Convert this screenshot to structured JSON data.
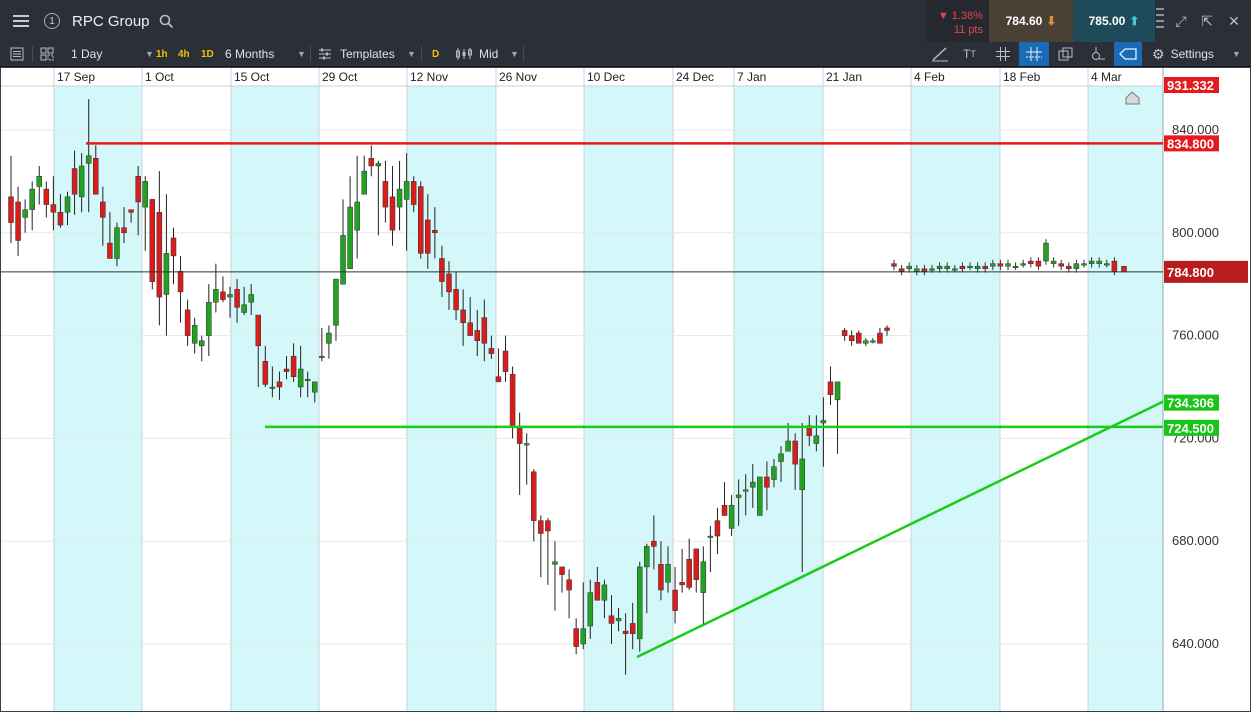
{
  "header": {
    "window_number": "1",
    "instrument": "RPC Group",
    "change_pct": "1.38%",
    "change_pts": "11 pts",
    "sell_price": "784.60",
    "buy_price": "785.00"
  },
  "toolbar": {
    "interval": "1 Day",
    "quick_timeframes": [
      "1h",
      "4h",
      "1D"
    ],
    "range": "6 Months",
    "templates": "Templates",
    "d_badge": "D",
    "price_type": "Mid",
    "settings": "Settings"
  },
  "chart": {
    "date_labels": [
      "17 Sep",
      "1 Oct",
      "15 Oct",
      "29 Oct",
      "12 Nov",
      "26 Nov",
      "10 Dec",
      "24 Dec",
      "7 Jan",
      "21 Jan",
      "4 Feb",
      "18 Feb",
      "4 Mar"
    ],
    "price_ticks": [
      "840.000",
      "800.000",
      "760.000",
      "720.000",
      "680.000",
      "640.000"
    ],
    "tags": {
      "top": "931.332",
      "resistance": "834.800",
      "current": "784.800",
      "trendline": "734.306",
      "support": "724.500"
    },
    "colors": {
      "up": "#22a122",
      "down": "#d81d1d",
      "resistance_line": "#e8191c",
      "support_line": "#18cc18",
      "band": "#d4f7f9",
      "current_tag": "#b81c1c"
    }
  },
  "chart_data": {
    "type": "candlestick",
    "title": "RPC Group",
    "timeframe": "1 Day",
    "y_ticks": [
      640,
      680,
      720,
      760,
      800,
      840
    ],
    "levels": {
      "resistance": 834.8,
      "support": 724.5,
      "current": 784.8,
      "trendline_end": 734.306,
      "axis_top": 931.332
    },
    "ohlc": [
      [
        814,
        830,
        796,
        804
      ],
      [
        812,
        818,
        791,
        797
      ],
      [
        806,
        813,
        800,
        809
      ],
      [
        809,
        820,
        801,
        817
      ],
      [
        818,
        826,
        811,
        822
      ],
      [
        817,
        820,
        806,
        811
      ],
      [
        811,
        822,
        801,
        808
      ],
      [
        808,
        815,
        802,
        803
      ],
      [
        808,
        816,
        803,
        814
      ],
      [
        825,
        832,
        807,
        815
      ],
      [
        814,
        831,
        808,
        826
      ],
      [
        827,
        852,
        808,
        830
      ],
      [
        829,
        834,
        815,
        815
      ],
      [
        812,
        818,
        795,
        806
      ],
      [
        796,
        808,
        790,
        790
      ],
      [
        790,
        804,
        787,
        802
      ],
      [
        802,
        810,
        796,
        800
      ],
      [
        809,
        809,
        804,
        808
      ],
      [
        822,
        826,
        799,
        812
      ],
      [
        810,
        822,
        793,
        820
      ],
      [
        813,
        813,
        778,
        781
      ],
      [
        808,
        824,
        764,
        775
      ],
      [
        776,
        815,
        760,
        792
      ],
      [
        798,
        802,
        780,
        791
      ],
      [
        785,
        791,
        765,
        777
      ],
      [
        770,
        774,
        756,
        760
      ],
      [
        757,
        767,
        753,
        764
      ],
      [
        756,
        760,
        750,
        758
      ],
      [
        760,
        780,
        752,
        773
      ],
      [
        773,
        788,
        769,
        778
      ],
      [
        777,
        783,
        773,
        774
      ],
      [
        775,
        779,
        767,
        776
      ],
      [
        778,
        782,
        765,
        771
      ],
      [
        769,
        779,
        768,
        772
      ],
      [
        773,
        780,
        768,
        776
      ],
      [
        768,
        768,
        740,
        756
      ],
      [
        750,
        756,
        740,
        741
      ],
      [
        740,
        748,
        736,
        740
      ],
      [
        742,
        746,
        735,
        740
      ],
      [
        747,
        752,
        743,
        746
      ],
      [
        752,
        757,
        742,
        744
      ],
      [
        740,
        756,
        736,
        747
      ],
      [
        743,
        746,
        736,
        743
      ],
      [
        738,
        740,
        734,
        742
      ],
      [
        752,
        763,
        750,
        752
      ],
      [
        757,
        764,
        751,
        761
      ],
      [
        764,
        780,
        758,
        782
      ],
      [
        780,
        813,
        782,
        799
      ],
      [
        786,
        822,
        786,
        810
      ],
      [
        801,
        830,
        790,
        812
      ],
      [
        815,
        830,
        817,
        824
      ],
      [
        829,
        834,
        822,
        826
      ],
      [
        826,
        828,
        799,
        827
      ],
      [
        820,
        828,
        804,
        810
      ],
      [
        814,
        826,
        795,
        801
      ],
      [
        810,
        828,
        801,
        817
      ],
      [
        813,
        831,
        793,
        820
      ],
      [
        820,
        822,
        808,
        811
      ],
      [
        818,
        820,
        790,
        792
      ],
      [
        805,
        815,
        786,
        792
      ],
      [
        801,
        810,
        790,
        800
      ],
      [
        790,
        795,
        775,
        781
      ],
      [
        784,
        789,
        770,
        777
      ],
      [
        778,
        785,
        766,
        770
      ],
      [
        770,
        778,
        756,
        765
      ],
      [
        765,
        775,
        760,
        760
      ],
      [
        762,
        770,
        752,
        758
      ],
      [
        767,
        774,
        750,
        757
      ],
      [
        755,
        760,
        751,
        753
      ],
      [
        744,
        755,
        742,
        742
      ],
      [
        754,
        760,
        742,
        746
      ],
      [
        745,
        748,
        720,
        725
      ],
      [
        724,
        730,
        698,
        718
      ],
      [
        718,
        722,
        702,
        718
      ],
      [
        707,
        708,
        680,
        688
      ],
      [
        688,
        690,
        666,
        683
      ],
      [
        688,
        689,
        663,
        684
      ],
      [
        671,
        680,
        653,
        672
      ],
      [
        670,
        670,
        660,
        667
      ],
      [
        665,
        669,
        650,
        661
      ],
      [
        646,
        650,
        636,
        639
      ],
      [
        640,
        664,
        638,
        646
      ],
      [
        647,
        665,
        642,
        660
      ],
      [
        664,
        670,
        657,
        657
      ],
      [
        657,
        665,
        650,
        663
      ],
      [
        651,
        659,
        640,
        648
      ],
      [
        649,
        654,
        645,
        650
      ],
      [
        645,
        652,
        628,
        644
      ],
      [
        648,
        656,
        638,
        644
      ],
      [
        642,
        672,
        637,
        670
      ],
      [
        670,
        679,
        652,
        678
      ],
      [
        680,
        690,
        669,
        678
      ],
      [
        671,
        680,
        657,
        661
      ],
      [
        664,
        678,
        660,
        671
      ],
      [
        661,
        670,
        648,
        653
      ],
      [
        664,
        677,
        660,
        663
      ],
      [
        673,
        681,
        661,
        662
      ],
      [
        677,
        676,
        660,
        665
      ],
      [
        660,
        678,
        647,
        672
      ],
      [
        682,
        686,
        668,
        682
      ],
      [
        688,
        693,
        675,
        682
      ],
      [
        694,
        703,
        690,
        690
      ],
      [
        685,
        698,
        682,
        694
      ],
      [
        697,
        704,
        686,
        698
      ],
      [
        700,
        706,
        690,
        700
      ],
      [
        701,
        710,
        693,
        703
      ],
      [
        690,
        700,
        695,
        705
      ],
      [
        705,
        711,
        692,
        701
      ],
      [
        704,
        712,
        701,
        709
      ],
      [
        711,
        717,
        703,
        714
      ],
      [
        715,
        726,
        715,
        719
      ],
      [
        719,
        722,
        700,
        710
      ],
      [
        700,
        726,
        668,
        712
      ],
      [
        725,
        729,
        717,
        721
      ],
      [
        718,
        729,
        715,
        721
      ],
      [
        726,
        736,
        709,
        727
      ],
      [
        742,
        748,
        733,
        737
      ],
      [
        735,
        740,
        714,
        742
      ],
      [
        762,
        763,
        758,
        760
      ],
      [
        760,
        762,
        756,
        758
      ],
      [
        761,
        762,
        757,
        757
      ],
      [
        757,
        759,
        756,
        758
      ],
      [
        758,
        759,
        757,
        758
      ],
      [
        761,
        763,
        757,
        757
      ],
      [
        763,
        764,
        760,
        762
      ]
    ]
  }
}
